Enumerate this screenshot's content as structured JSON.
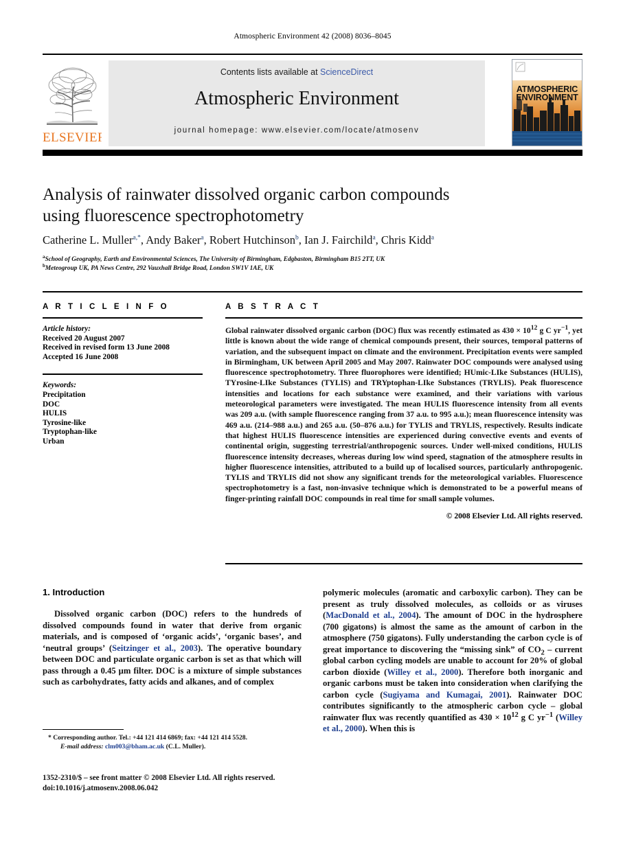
{
  "running_head": "Atmospheric Environment 42 (2008) 8036–8045",
  "masthead": {
    "contents_prefix": "Contents lists available at ",
    "sciencedirect": "ScienceDirect",
    "journal_title": "Atmospheric Environment",
    "homepage": "journal homepage: www.elsevier.com/locate/atmosenv",
    "publisher_wordmark": "ELSEVIER",
    "publisher_logo_icon": "elsevier-tree-icon",
    "cover_title_line1": "ATMOSPHERIC",
    "cover_title_line2": "ENVIRONMENT",
    "accent_orange": "#E87722",
    "link_blue": "#3b5aa8",
    "band_gray": "#e8e8e8"
  },
  "article": {
    "title_line1": "Analysis of rainwater dissolved organic carbon compounds",
    "title_line2": "using fluorescence spectrophotometry",
    "authors_plain": "Catherine L. Muller a,*, Andy Baker a, Robert Hutchinson b, Ian J. Fairchild a, Chris Kidd a",
    "authors": [
      {
        "name": "Catherine L. Muller",
        "sup": "a,",
        "star": "*"
      },
      {
        "name": "Andy Baker",
        "sup": "a"
      },
      {
        "name": "Robert Hutchinson",
        "sup": "b"
      },
      {
        "name": "Ian J. Fairchild",
        "sup": "a"
      },
      {
        "name": "Chris Kidd",
        "sup": "a"
      }
    ],
    "affiliations": [
      {
        "marker": "a",
        "text": "School of Geography, Earth and Environmental Sciences, The University of Birmingham, Edgbaston, Birmingham B15 2TT, UK"
      },
      {
        "marker": "b",
        "text": "Meteogroup UK, PA News Centre, 292 Vauxhall Bridge Road, London SW1V 1AE, UK"
      }
    ]
  },
  "article_info": {
    "heading": "A R T I C L E   I N F O",
    "history_label": "Article history:",
    "history": [
      "Received 20 August 2007",
      "Received in revised form 13 June 2008",
      "Accepted 16 June 2008"
    ],
    "keywords_label": "Keywords:",
    "keywords": [
      "Precipitation",
      "DOC",
      "HULIS",
      "Tyrosine-like",
      "Tryptophan-like",
      "Urban"
    ]
  },
  "abstract": {
    "heading": "A B S T R A C T",
    "paragraph_part1": "Global rainwater dissolved organic carbon (DOC) flux was recently estimated as 430 × 10",
    "exp1": "12",
    "paragraph_part2": " g C yr",
    "exp2": "−1",
    "paragraph_part3": ", yet little is known about the wide range of chemical compounds present, their sources, temporal patterns of variation, and the subsequent impact on climate and the environment. Precipitation events were sampled in Birmingham, UK between April 2005 and May 2007. Rainwater DOC compounds were analysed using fluorescence spectrophotometry. Three fluorophores were identified; HUmic-LIke Substances (HULIS), TYrosine-LIke Substances (TYLIS) and TRYptophan-LIke Substances (TRYLIS). Peak fluorescence intensities and locations for each substance were examined, and their variations with various meteorological parameters were investigated. The mean HULIS fluorescence intensity from all events was 209 a.u. (with sample fluorescence ranging from 37 a.u. to 995 a.u.); mean fluorescence intensity was 469 a.u. (214–988 a.u.) and 265 a.u. (50–876 a.u.) for TYLIS and TRYLIS, respectively. Results indicate that highest HULIS fluorescence intensities are experienced during convective events and events of continental origin, suggesting terrestrial/anthropogenic sources. Under well-mixed conditions, HULIS fluorescence intensity decreases, whereas during low wind speed, stagnation of the atmosphere results in higher fluorescence intensities, attributed to a build up of localised sources, particularly anthropogenic. TYLIS and TRYLIS did not show any significant trends for the meteorological variables. Fluorescence spectrophotometry is a fast, non-invasive technique which is demonstrated to be a powerful means of finger-printing rainfall DOC compounds in real time for small sample volumes.",
    "copyright": "© 2008 Elsevier Ltd. All rights reserved."
  },
  "body": {
    "section_number_title": "1. Introduction",
    "left_part1": "Dissolved organic carbon (DOC) refers to the hundreds of dissolved compounds found in water that derive from organic materials, and is composed of ‘organic acids’, ‘organic bases’, and ‘neutral groups’ (",
    "left_cite1": "Seitzinger et al., 2003",
    "left_part2": "). The operative boundary between DOC and particulate organic carbon is set as that which will pass through a 0.45 μm filter. DOC is a mixture of simple substances such as carbohydrates, fatty acids and alkanes, and of complex",
    "right_part1": "polymeric molecules (aromatic and carboxylic carbon). They can be present as truly dissolved molecules, as colloids or as viruses (",
    "right_cite1": "MacDonald et al., 2004",
    "right_part2": "). The amount of DOC in the hydrosphere (700 gigatons) is almost the same as the amount of carbon in the atmosphere (750 gigatons). Fully understanding the carbon cycle is of great importance to discovering the “missing sink” of CO",
    "right_sub1": "2",
    "right_part3": " – current global carbon cycling models are unable to account for 20% of global carbon dioxide (",
    "right_cite2": "Willey et al., 2000",
    "right_part4": "). Therefore both inorganic and organic carbons must be taken into consideration when clarifying the carbon cycle (",
    "right_cite3": "Sugiyama and Kumagai, 2001",
    "right_part5": "). Rainwater DOC contributes significantly to the atmospheric carbon cycle – global rainwater flux was recently quantified as 430 × 10",
    "right_exp1": "12",
    "right_part6": " g C yr",
    "right_exp2": "−1",
    "right_part7": " (",
    "right_cite4": "Willey et al., 2000",
    "right_part8": "). When this is"
  },
  "footnotes": {
    "corresponding_marker": "*",
    "corresponding_text": "Corresponding author. Tel.: +44 121 414 6869; fax: +44 121 414 5528.",
    "email_label": "E-mail address:",
    "email": "clm003@bham.ac.uk",
    "email_owner": "(C.L. Muller).",
    "imprint_line1": "1352-2310/$ – see front matter © 2008 Elsevier Ltd. All rights reserved.",
    "imprint_line2": "doi:10.1016/j.atmosenv.2008.06.042"
  }
}
